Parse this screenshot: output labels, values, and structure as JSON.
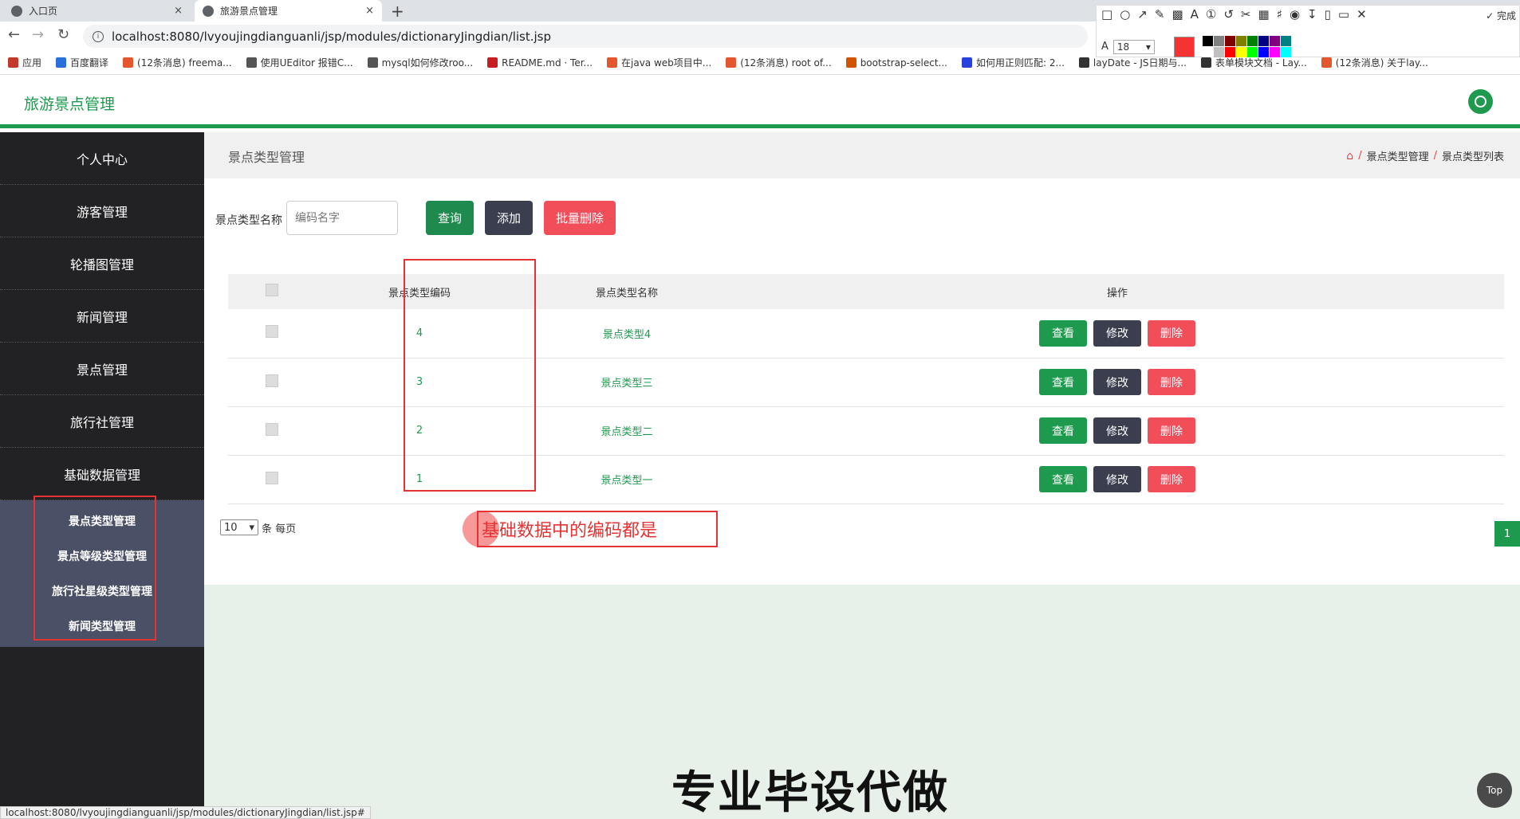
{
  "browser": {
    "tabs": [
      {
        "title": "入口页",
        "close": "×"
      },
      {
        "title": "旅游景点管理",
        "close": "×"
      }
    ],
    "new_tab": "+",
    "url": "localhost:8080/lvyoujingdianguanli/jsp/modules/dictionaryJingdian/list.jsp",
    "bookmarks": [
      {
        "label": "应用",
        "color": "#c0392b"
      },
      {
        "label": "百度翻译",
        "color": "#2a6fdb"
      },
      {
        "label": "(12条消息) freema...",
        "color": "#e4572e"
      },
      {
        "label": "使用UEditor 报错C...",
        "color": "#555555"
      },
      {
        "label": "mysql如何修改roo...",
        "color": "#555555"
      },
      {
        "label": "README.md · Ter...",
        "color": "#c71d23"
      },
      {
        "label": "在java web项目中...",
        "color": "#e4572e"
      },
      {
        "label": "(12条消息) root of...",
        "color": "#e4572e"
      },
      {
        "label": "bootstrap-select...",
        "color": "#d35400"
      },
      {
        "label": "如何用正则匹配: 2...",
        "color": "#2a3fdb"
      },
      {
        "label": "layDate - JS日期与...",
        "color": "#333333"
      },
      {
        "label": "表单模块文档 - Lay...",
        "color": "#333333"
      },
      {
        "label": "(12条消息) 关于lay...",
        "color": "#e4572e"
      }
    ],
    "status_url": "localhost:8080/lvyoujingdianguanli/jsp/modules/dictionaryJingdian/list.jsp#"
  },
  "annotation_tool": {
    "done_label": "完成",
    "font_size": "18",
    "current_color": "#f53333",
    "palette": [
      "#000000",
      "#808080",
      "#800000",
      "#808000",
      "#008000",
      "#000080",
      "#800080",
      "#008080",
      "#ffffff",
      "#c0c0c0",
      "#ff0000",
      "#ffff00",
      "#00ff00",
      "#0000ff",
      "#ff00ff",
      "#00ffff"
    ]
  },
  "app": {
    "title": "旅游景点管理",
    "brand_color": "#1e9a4e"
  },
  "sidebar": {
    "items": [
      "个人中心",
      "游客管理",
      "轮播图管理",
      "新闻管理",
      "景点管理",
      "旅行社管理",
      "基础数据管理"
    ],
    "submenu": [
      "景点类型管理",
      "景点等级类型管理",
      "旅行社星级类型管理",
      "新闻类型管理"
    ]
  },
  "page": {
    "title": "景点类型管理",
    "breadcrumb": [
      "景点类型管理",
      "景点类型列表"
    ],
    "breadcrumb_sep": "/"
  },
  "search": {
    "label": "景点类型名称",
    "placeholder": "编码名字",
    "query_label": "查询",
    "add_label": "添加",
    "batch_delete_label": "批量删除"
  },
  "table": {
    "headers": [
      "景点类型编码",
      "景点类型名称",
      "操作"
    ],
    "rows": [
      {
        "code": "4",
        "name": "景点类型4"
      },
      {
        "code": "3",
        "name": "景点类型三"
      },
      {
        "code": "2",
        "name": "景点类型二"
      },
      {
        "code": "1",
        "name": "景点类型一"
      }
    ],
    "actions": {
      "view": "查看",
      "edit": "修改",
      "delete": "删除"
    }
  },
  "pagination": {
    "page_size": "10",
    "per_page_label": "条 每页",
    "current_page": "1"
  },
  "overlay": {
    "annotation_text": "基础数据中的编码都是",
    "watermark": "专业毕设代做",
    "top_button": "Top"
  }
}
